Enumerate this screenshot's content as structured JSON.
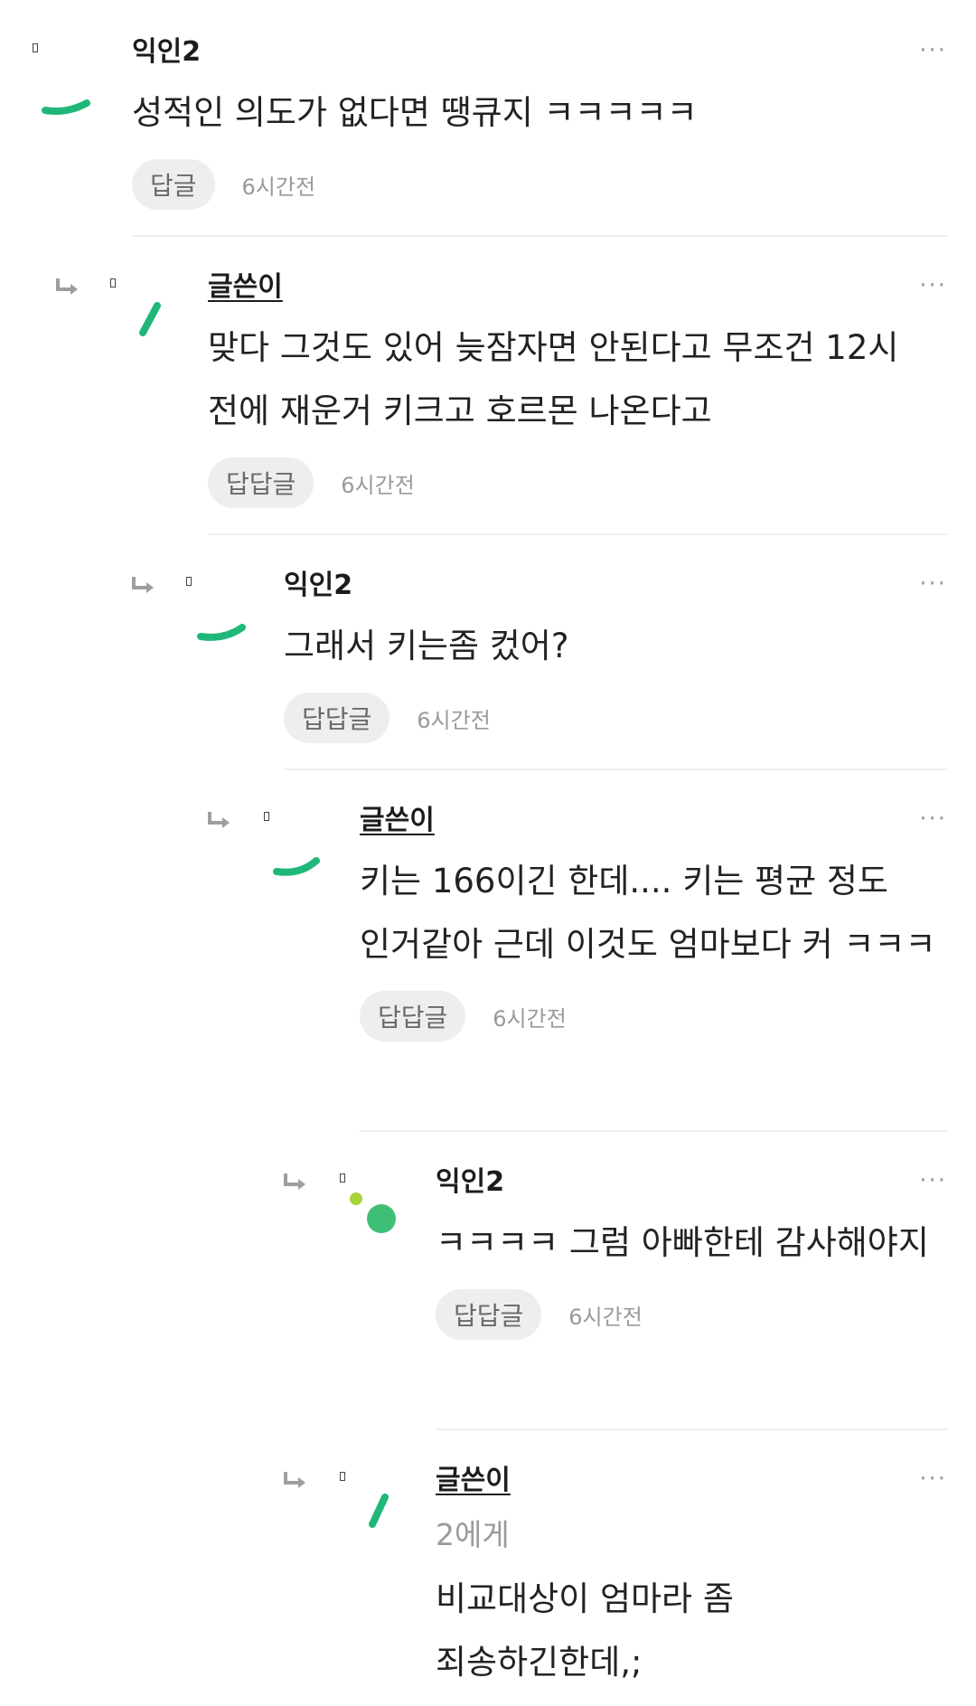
{
  "comments": [
    {
      "author": "익인2",
      "is_op": false,
      "text": "성적인 의도가 없다면 땡큐지 ㅋㅋㅋㅋㅋ",
      "reply_label": "답글",
      "time": "6시간전",
      "more": "···"
    },
    {
      "author": "글쓴이",
      "is_op": true,
      "text": "맞다 그것도 있어 늦잠자면 안된다고 무조건 12시 전에 재운거 키크고 호르몬 나온다고",
      "reply_label": "답답글",
      "time": "6시간전",
      "more": "···"
    },
    {
      "author": "익인2",
      "is_op": false,
      "text": "그래서 키는좀 컸어?",
      "reply_label": "답답글",
      "time": "6시간전",
      "more": "···"
    },
    {
      "author": "글쓴이",
      "is_op": true,
      "text": "키는 166이긴 한데.... 키는 평균 정도 인거같아 근데 이것도 엄마보다 커 ㅋㅋㅋ",
      "reply_label": "답답글",
      "time": "6시간전",
      "more": "···"
    },
    {
      "author": "익인2",
      "is_op": false,
      "text": "ㅋㅋㅋㅋ 그럼 아빠한테 감사해야지",
      "reply_label": "답답글",
      "time": "6시간전",
      "more": "···"
    },
    {
      "author": "글쓴이",
      "is_op": true,
      "target": "2에게",
      "text": "비교대상이 엄마라 좀 죄송하긴한데,;",
      "more": "···"
    }
  ],
  "colors": {
    "accent_green": "#1fb77a",
    "light_green": "#a6d43a",
    "muted_text": "#9a9a9a",
    "chip_bg": "#eeeeee"
  },
  "icons": [
    "reply-arrow-icon",
    "more-options-icon",
    "avatar-icon"
  ]
}
